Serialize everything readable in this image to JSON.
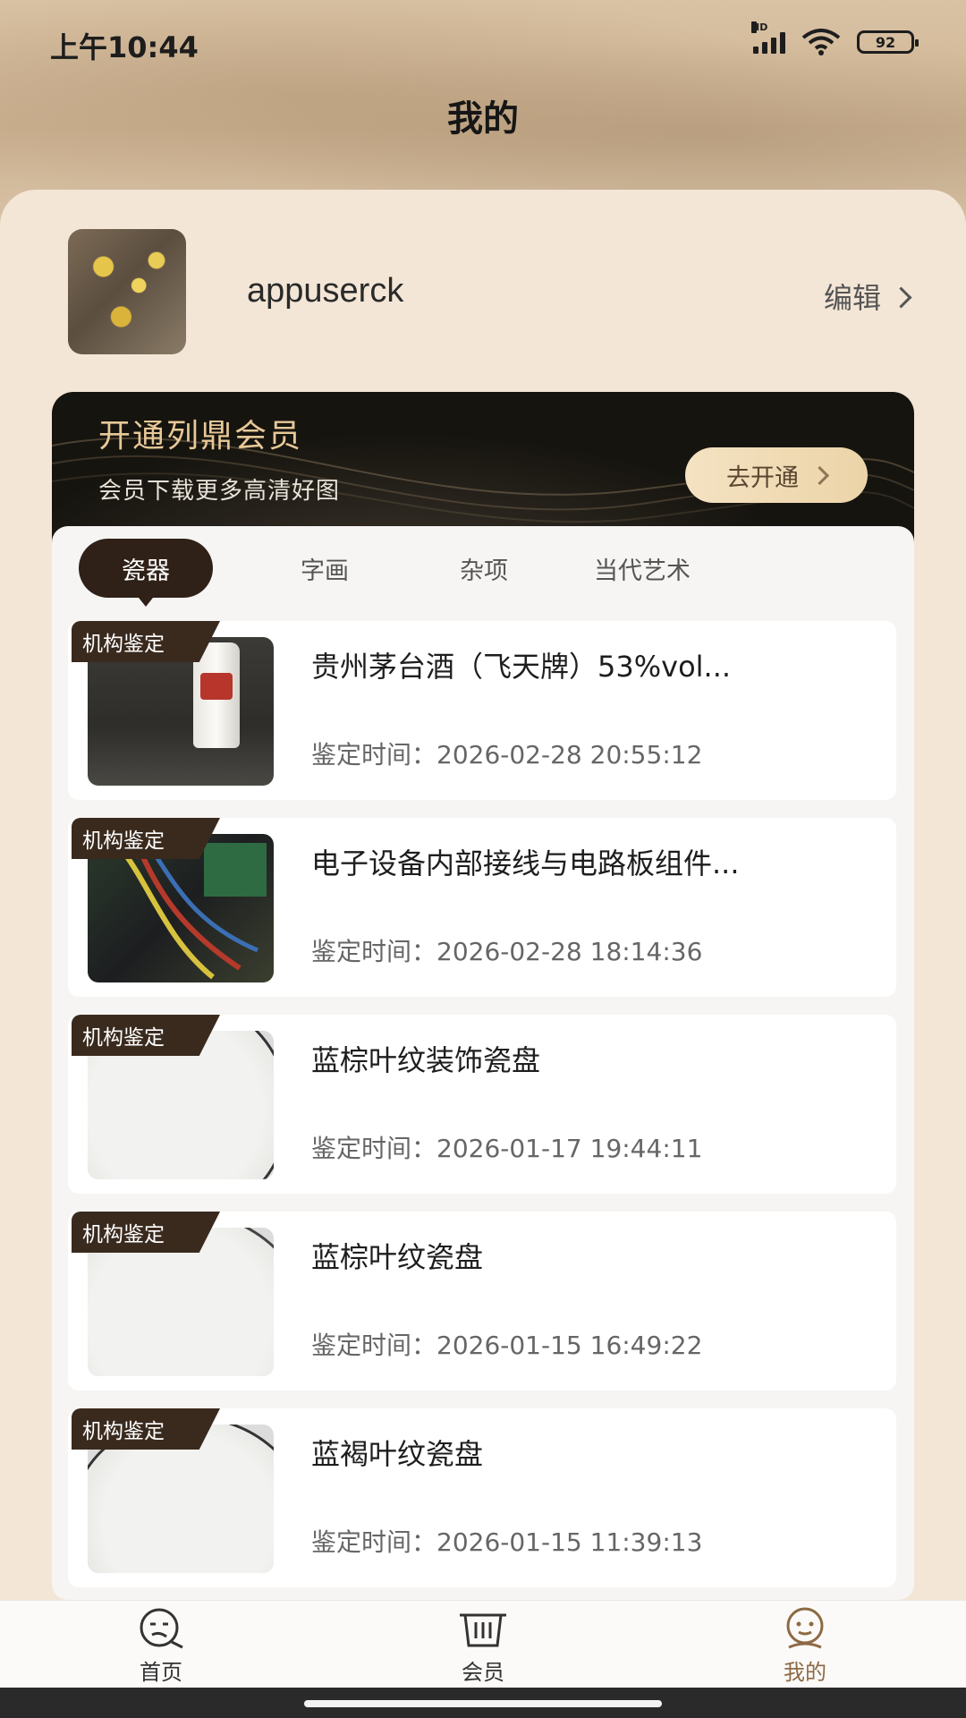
{
  "status": {
    "time": "上午10:44",
    "battery": "92",
    "network": "HD"
  },
  "header": {
    "title": "我的"
  },
  "profile": {
    "username": "appuserck",
    "edit_label": "编辑"
  },
  "vip": {
    "title": "开通列鼎会员",
    "subtitle": "会员下载更多高清好图",
    "button_label": "去开通"
  },
  "tabs": [
    {
      "label": "瓷器",
      "active": true
    },
    {
      "label": "字画",
      "active": false
    },
    {
      "label": "杂项",
      "active": false
    },
    {
      "label": "当代艺术",
      "active": false
    }
  ],
  "items": [
    {
      "badge": "机构鉴定",
      "title": "贵州茅台酒（飞天牌）53%vol...",
      "time": "鉴定时间：2026-02-28 20:55:12"
    },
    {
      "badge": "机构鉴定",
      "title": "电子设备内部接线与电路板组件...",
      "time": "鉴定时间：2026-02-28 18:14:36"
    },
    {
      "badge": "机构鉴定",
      "title": "蓝棕叶纹装饰瓷盘",
      "time": "鉴定时间：2026-01-17 19:44:11"
    },
    {
      "badge": "机构鉴定",
      "title": "蓝棕叶纹瓷盘",
      "time": "鉴定时间：2026-01-15 16:49:22"
    },
    {
      "badge": "机构鉴定",
      "title": "蓝褐叶纹瓷盘",
      "time": "鉴定时间：2026-01-15 11:39:13"
    }
  ],
  "nav": [
    {
      "label": "首页",
      "icon": "home-face-icon",
      "active": false
    },
    {
      "label": "会员",
      "icon": "basket-icon",
      "active": false
    },
    {
      "label": "我的",
      "icon": "profile-face-icon",
      "active": true
    }
  ],
  "colors": {
    "accent": "#8d6a44",
    "tab_active": "#2f2117",
    "vip_gold": "#e7c897"
  }
}
